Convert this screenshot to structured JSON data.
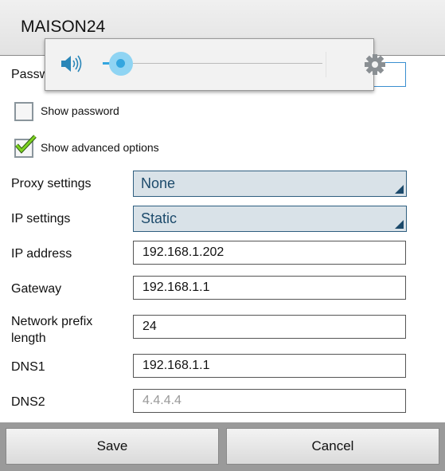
{
  "header": {
    "title": "MAISON24"
  },
  "form": {
    "password_label": "Password",
    "show_password": {
      "label": "Show password",
      "checked": false
    },
    "show_advanced": {
      "label": "Show advanced options",
      "checked": true
    },
    "proxy": {
      "label": "Proxy settings",
      "value": "None"
    },
    "ip_settings": {
      "label": "IP settings",
      "value": "Static"
    },
    "ip_address": {
      "label": "IP address",
      "value": "192.168.1.202"
    },
    "gateway": {
      "label": "Gateway",
      "value": "192.168.1.1"
    },
    "prefix": {
      "label_line1": "Network prefix",
      "label_line2": "length",
      "value": "24"
    },
    "dns1": {
      "label": "DNS1",
      "value": "192.168.1.1"
    },
    "dns2": {
      "label": "DNS2",
      "placeholder": "4.4.4.4"
    }
  },
  "volume_popup": {
    "icon": "speaker-icon",
    "level_percent": 3,
    "settings_icon": "gear-icon",
    "accent": "#33a6df"
  },
  "buttons": {
    "save": "Save",
    "cancel": "Cancel"
  }
}
